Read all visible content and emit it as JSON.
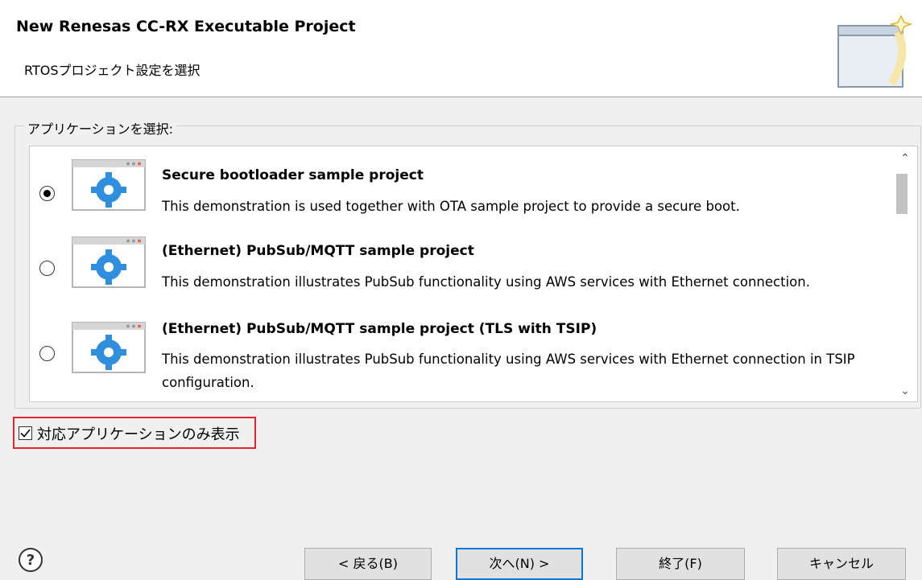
{
  "dialog": {
    "title": "New Renesas CC-RX Executable Project",
    "subtitle": "RTOSプロジェクト設定を選択"
  },
  "group": {
    "label": "アプリケーションを選択:"
  },
  "applications": [
    {
      "selected": true,
      "title": "Secure bootloader sample project",
      "description": "This demonstration is used together with OTA sample project to provide a secure boot."
    },
    {
      "selected": false,
      "title": "(Ethernet) PubSub/MQTT sample project",
      "description": "This demonstration illustrates PubSub functionality using AWS services with Ethernet connection."
    },
    {
      "selected": false,
      "title": "(Ethernet) PubSub/MQTT sample project (TLS with TSIP)",
      "description": "This demonstration illustrates PubSub functionality using AWS services with Ethernet connection in TSIP configuration."
    }
  ],
  "filter": {
    "checked": true,
    "label": "対応アプリケーションのみ表示"
  },
  "buttons": {
    "back": "< 戻る(B)",
    "next": "次へ(N) >",
    "finish": "終了(F)",
    "cancel": "キャンセル"
  },
  "icons": {
    "help": "help-icon",
    "app": "gear-window-icon",
    "wizard": "wizard-banner-icon"
  },
  "colors": {
    "accent": "#0078d7",
    "highlight": "#e0262f",
    "gear": "#2f8fdc"
  }
}
